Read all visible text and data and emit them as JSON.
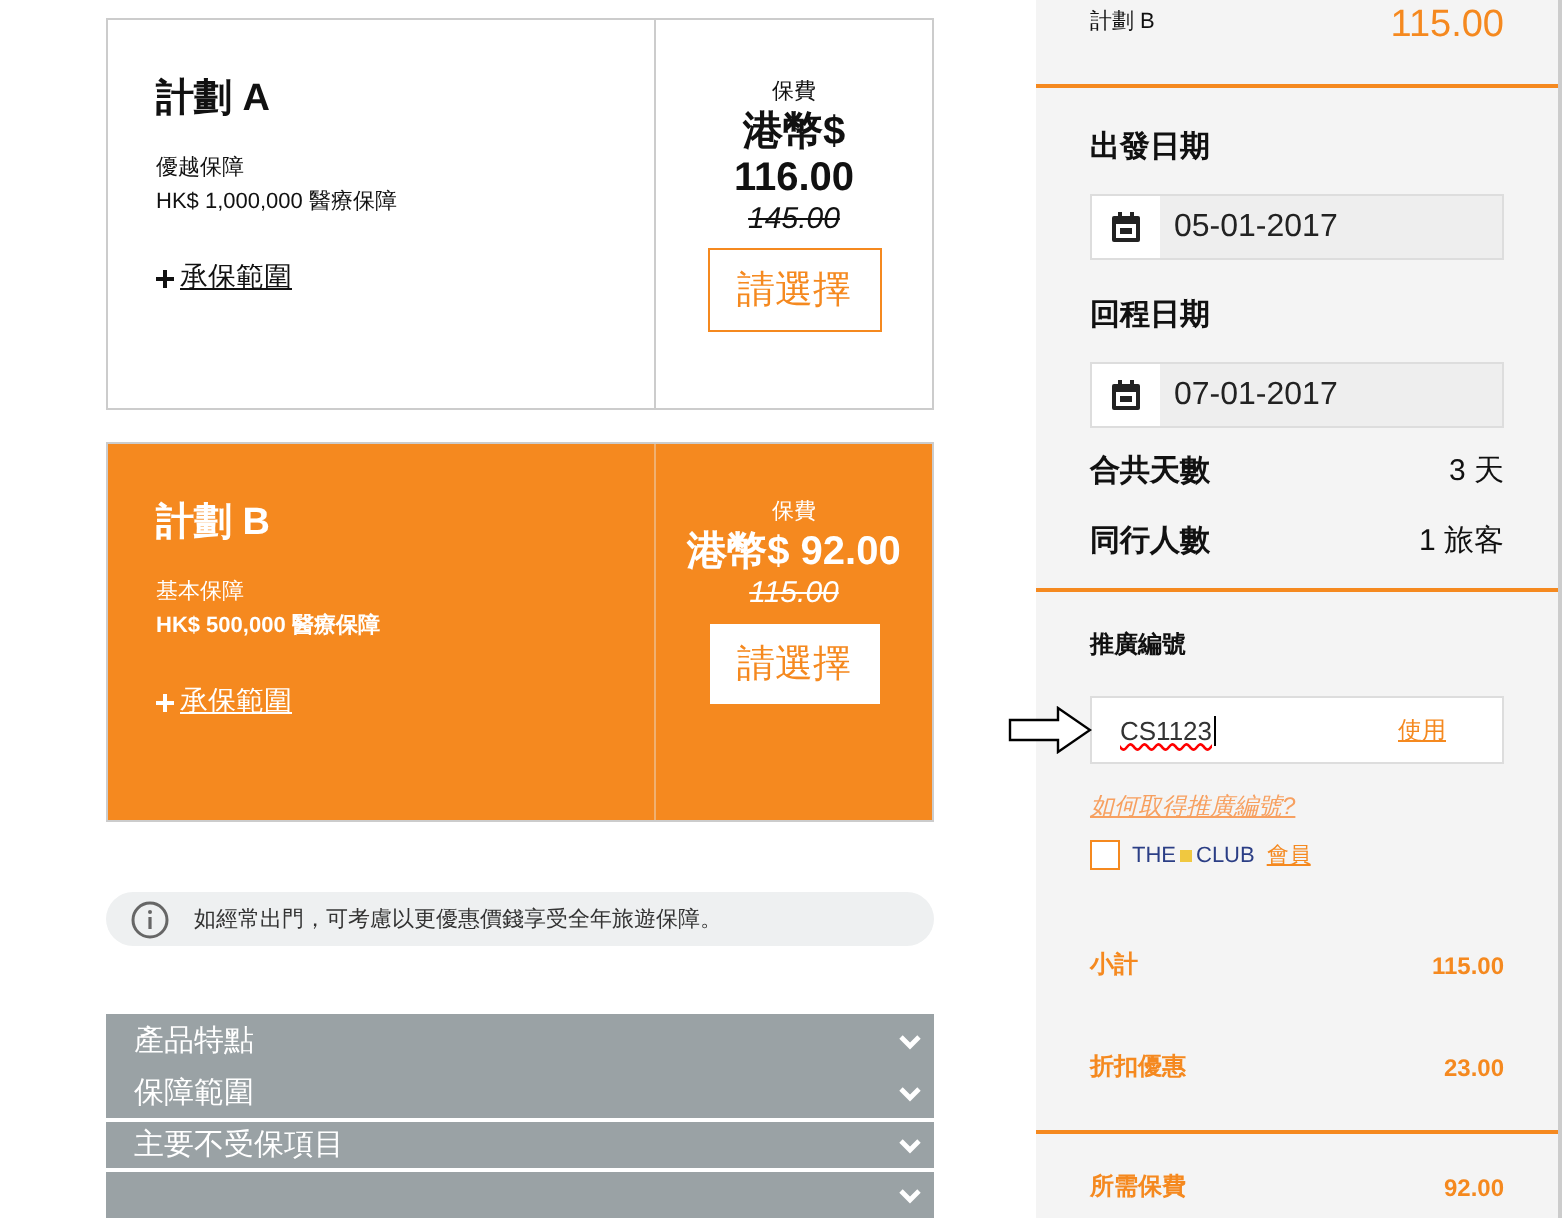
{
  "plans": [
    {
      "name": "計劃 A",
      "tier": "優越保障",
      "coverage": "HK$ 1,000,000 醫療保障",
      "coverage_link": "承保範圍",
      "fee_label": "保費",
      "price": "港幣$ 116.00",
      "old_price": "145.00",
      "button": "請選擇",
      "selected": false
    },
    {
      "name": "計劃 B",
      "tier": "基本保障",
      "coverage": "HK$ 500,000 醫療保障",
      "coverage_link": "承保範圍",
      "fee_label": "保費",
      "price": "港幣$ 92.00",
      "old_price": "115.00",
      "button": "請選擇",
      "selected": true
    }
  ],
  "info": "如經常出門，可考慮以更優惠價錢享受全年旅遊保障。",
  "accordion": [
    {
      "title": "產品特點",
      "expanded": false
    },
    {
      "title": "保障範圍",
      "expanded": false
    },
    {
      "title": "主要不受保項目",
      "expanded": false
    },
    {
      "expanded": false
    }
  ],
  "sidebar": {
    "summary": {
      "plan": "計劃 B",
      "amount": "115.00"
    },
    "dates": [
      {
        "label": "出發日期",
        "value": "05-01-2017"
      },
      {
        "label": "回程日期",
        "value": "07-01-2017"
      }
    ],
    "facts": [
      {
        "label": "合共天數",
        "value": "3 天"
      },
      {
        "label": "同行人數",
        "value": "1 旅客"
      }
    ],
    "promo": {
      "label": "推廣編號",
      "value": "CS1123",
      "apply": "使用",
      "help": "如何取得推廣編號?"
    },
    "club": {
      "checked": false,
      "brand_left": "THE",
      "brand_right": "CLUB",
      "link": "會員"
    },
    "totals": [
      {
        "label": "小計",
        "value": "115.00",
        "kind": "line"
      },
      {
        "label": "折扣優惠",
        "value": "23.00",
        "kind": "line"
      },
      {
        "label": "所需保費",
        "value": "92.00",
        "kind": "total"
      }
    ]
  }
}
